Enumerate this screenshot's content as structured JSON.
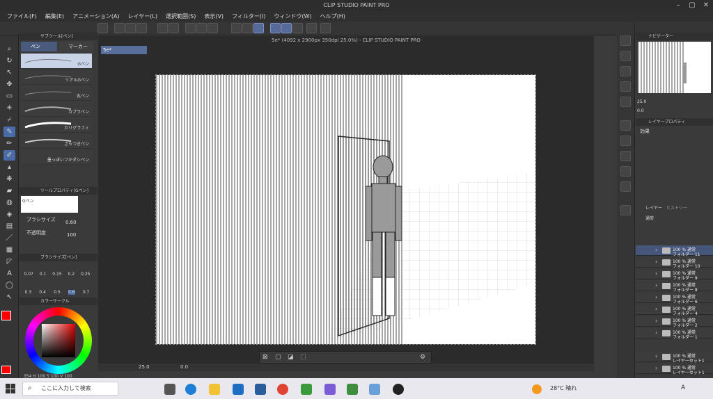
{
  "window": {
    "title": "CLIP STUDIO PAINT PRO"
  },
  "menu": [
    "ファイル(F)",
    "編集(E)",
    "アニメーション(A)",
    "レイヤー(L)",
    "選択範囲(S)",
    "表示(V)",
    "フィルター(I)",
    "ウィンドウ(W)",
    "ヘルプ(H)"
  ],
  "subtool": {
    "header": "サブツール[ペン]",
    "tabs": [
      "ペン",
      "マーカー"
    ],
    "brushes": [
      "Gペン",
      "リアルGペン",
      "丸ペン",
      "カブラペン",
      "カリグラフィ",
      "ざらつきペン",
      "墨っぽいフキダシペン"
    ]
  },
  "toolprop": {
    "header": "ツールプロパティ[Gペン]",
    "name": "Gペン",
    "size_label": "ブラシサイズ",
    "size_value": "0.60",
    "opacity_label": "不透明度",
    "opacity_value": "100"
  },
  "brushsize": {
    "header": "ブラシサイズ[ペン]",
    "row1": [
      "0.07",
      "0.1",
      "0.15",
      "0.2",
      "0.25"
    ],
    "row2": [
      "0.3",
      "0.4",
      "0.5",
      "0.6",
      "0.7"
    ]
  },
  "colorwheel": {
    "header": "カラーサークル",
    "readout": "354 H 100 S 100 V 100"
  },
  "document": {
    "title": "5e* (4092 x 2900px 350dpi 25.0%) - CLIP STUDIO PAINT PRO",
    "tab": "5e*"
  },
  "statusbar": {
    "zoom": "25.0",
    "rotation": "0.0"
  },
  "navigator": {
    "header": "ナビゲーター",
    "zoom": "25.0",
    "rotation": "0.0"
  },
  "layerprop": {
    "header": "レイヤープロパティ",
    "effect_label": "効果"
  },
  "layers": {
    "tabs": [
      "レイヤー",
      "ヒストリー"
    ],
    "blend": "通常",
    "rows": [
      {
        "line1": "100 % 通常",
        "line2": "フォルダー 11"
      },
      {
        "line1": "100 % 通常",
        "line2": "フォルダー 10"
      },
      {
        "line1": "100 % 通常",
        "line2": "フォルダー 9"
      },
      {
        "line1": "100 % 通常",
        "line2": "フォルダー 8"
      },
      {
        "line1": "100 % 通常",
        "line2": "フォルダー 6"
      },
      {
        "line1": "100 % 通常",
        "line2": "フォルダー 4"
      },
      {
        "line1": "100 % 通常",
        "line2": "フォルダー 2"
      },
      {
        "line1": "100 % 通常",
        "line2": "フォルダー 1"
      },
      {
        "line1": "100 % 通常",
        "line2": "レイヤーセット1"
      },
      {
        "line1": "100 % 通常",
        "line2": "レイヤーセット1"
      }
    ]
  },
  "taskbar": {
    "search_placeholder": "ここに入力して検索",
    "weather": "28°C 晴れ",
    "ime": "A"
  },
  "colors": {
    "accent": "#4a6aa8",
    "main_color": "#ff0000",
    "sub_color": "#1e5ed8"
  }
}
